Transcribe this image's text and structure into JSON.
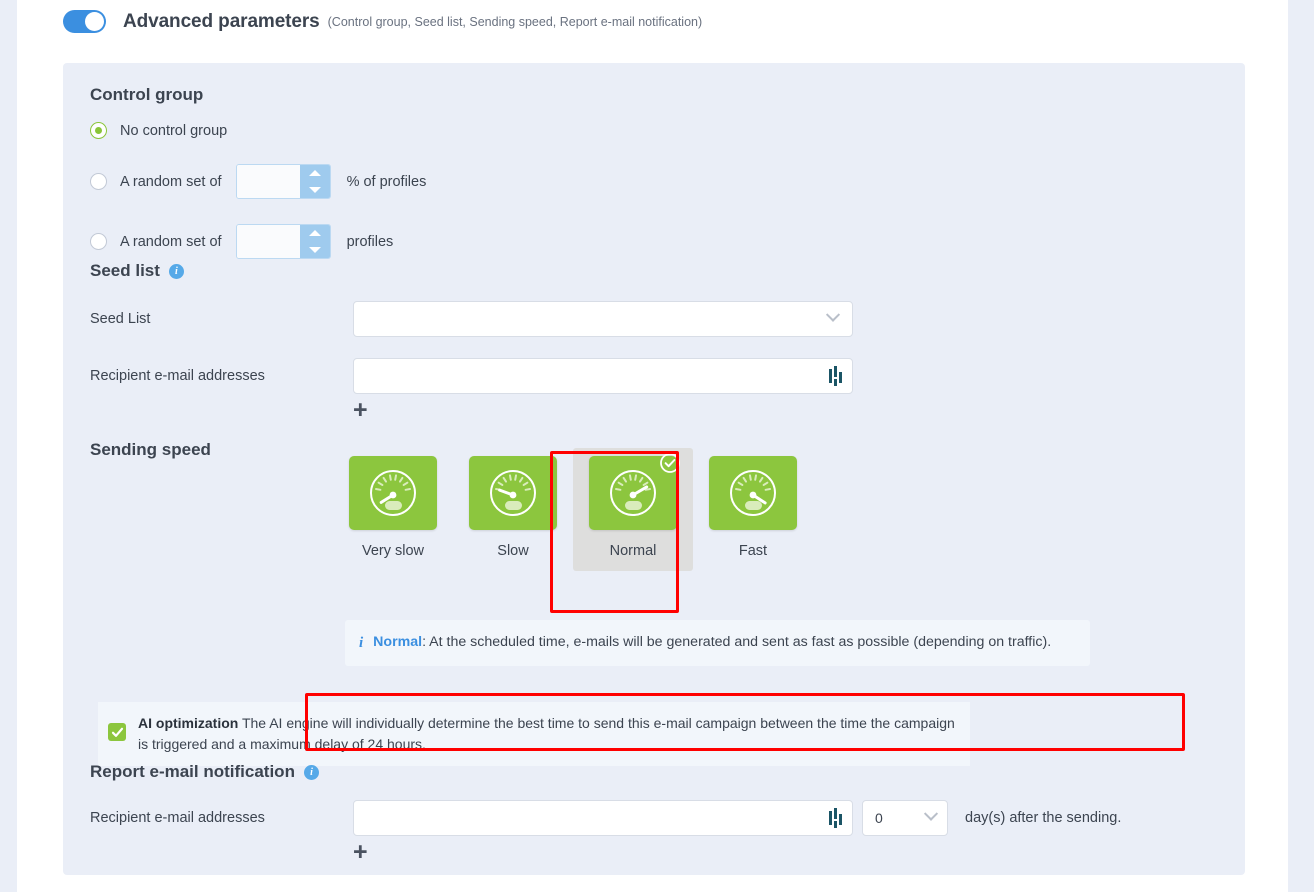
{
  "header": {
    "title": "Advanced parameters",
    "subtitle": "(Control group, Seed list, Sending speed, Report e-mail notification)",
    "toggle_state": "on"
  },
  "control_group": {
    "title": "Control group",
    "options": [
      {
        "label": "No control group",
        "selected": true
      },
      {
        "label": "A random set of",
        "value": "",
        "unit": "% of profiles",
        "selected": false
      },
      {
        "label": "A random set of",
        "value": "",
        "unit": "profiles",
        "selected": false
      }
    ]
  },
  "seed_list": {
    "title": "Seed list",
    "seed_list_label": "Seed List",
    "seed_list_value": "",
    "recipient_label": "Recipient e-mail addresses",
    "recipient_value": "",
    "add_label": "+"
  },
  "sending_speed": {
    "title": "Sending speed",
    "tiles": [
      {
        "label": "Very slow",
        "selected": false,
        "needle": 212
      },
      {
        "label": "Slow",
        "selected": false,
        "needle": 250
      },
      {
        "label": "Normal",
        "selected": true,
        "needle": 305
      },
      {
        "label": "Fast",
        "selected": false,
        "needle": 342
      }
    ],
    "notice_title": "Normal",
    "notice_text": ": At the scheduled time, e-mails will be generated and sent as fast as possible (depending on traffic).",
    "ai_title": "AI optimization",
    "ai_text": " The AI engine will individually determine the best time to send this e-mail campaign between the time the campaign is triggered and a maximum delay of 24 hours.",
    "ai_checked": true
  },
  "report": {
    "title": "Report e-mail notification",
    "recipient_label": "Recipient e-mail addresses",
    "recipient_value": "",
    "days_value": "0",
    "days_suffix": "day(s) after the sending.",
    "add_label": "+"
  },
  "colors": {
    "accent_blue": "#3b8fe0",
    "green": "#8cc63e",
    "panel_bg": "#eaeef7",
    "highlight_red": "#ff0000",
    "selected_tile_bg": "#dededd"
  }
}
